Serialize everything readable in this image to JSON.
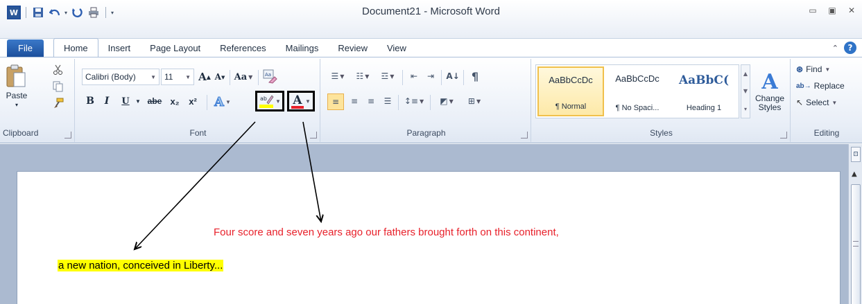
{
  "window": {
    "title": "Document21 - Microsoft Word",
    "app_letter": "W"
  },
  "tabs": [
    {
      "label": "File"
    },
    {
      "label": "Home"
    },
    {
      "label": "Insert"
    },
    {
      "label": "Page Layout"
    },
    {
      "label": "References"
    },
    {
      "label": "Mailings"
    },
    {
      "label": "Review"
    },
    {
      "label": "View"
    }
  ],
  "active_tab": "Home",
  "ribbon": {
    "clipboard": {
      "label": "Clipboard",
      "paste": "Paste"
    },
    "font": {
      "label": "Font",
      "font_name": "Calibri (Body)",
      "font_size": "11",
      "case_label": "Aa",
      "bold": "B",
      "italic": "I",
      "underline": "U",
      "strike": "abe",
      "subscript": "x₂",
      "superscript": "x²",
      "font_color_letter": "A",
      "highlight_color": "#ffff00",
      "font_color": "#e8202a"
    },
    "paragraph": {
      "label": "Paragraph"
    },
    "styles": {
      "label": "Styles",
      "tiles": [
        {
          "sample": "AaBbCcDc",
          "name": "¶ Normal"
        },
        {
          "sample": "AaBbCcDc",
          "name": "¶ No Spaci..."
        },
        {
          "sample": "AaBbC(",
          "name": "Heading 1"
        }
      ],
      "change_styles": "Change Styles"
    },
    "editing": {
      "label": "Editing",
      "find": "Find",
      "replace": "Replace",
      "select": "Select"
    }
  },
  "document": {
    "line1": "Four score and seven years ago our fathers brought forth on this continent,",
    "line2": "a new nation, conceived in Liberty..."
  },
  "colors": {
    "accent": "#2b5797",
    "text_red": "#e8202a",
    "highlight": "#ffff00"
  }
}
